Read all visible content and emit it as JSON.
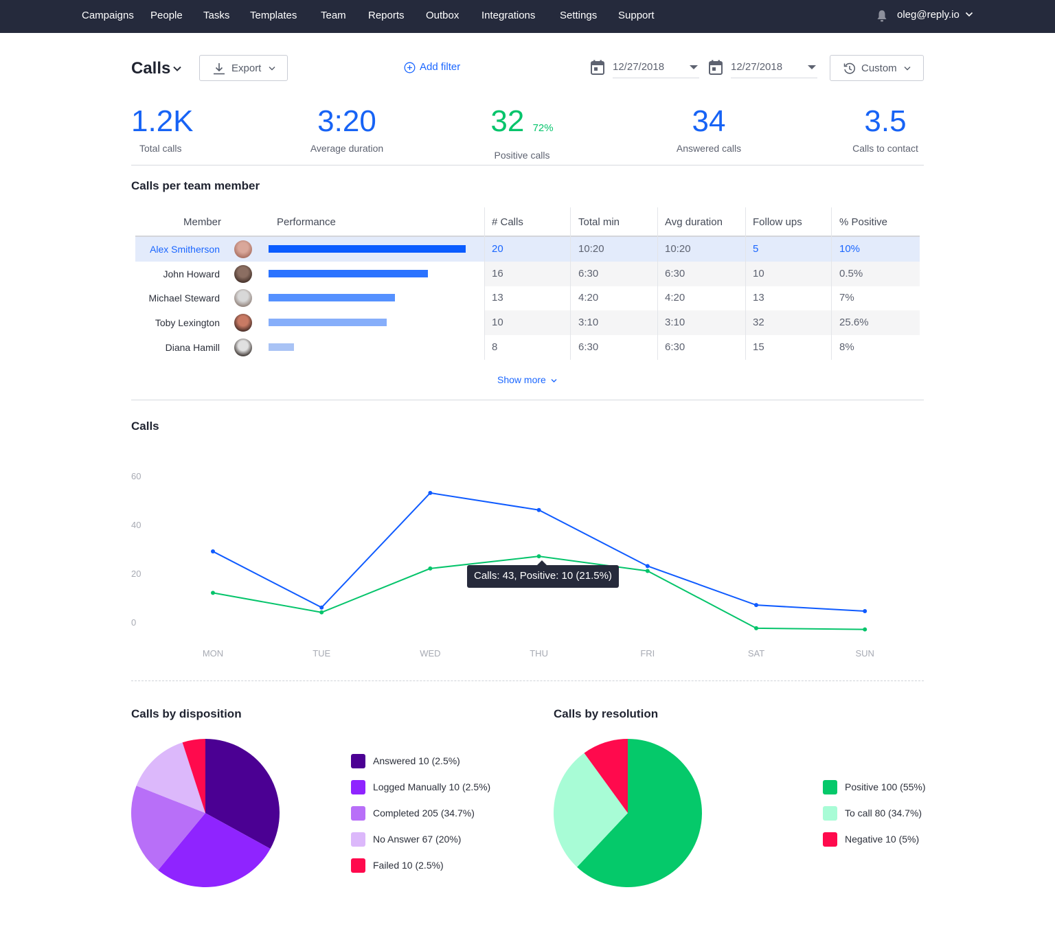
{
  "nav": {
    "items": [
      "Campaigns",
      "People",
      "Tasks",
      "Templates",
      "Team",
      "Reports",
      "Outbox",
      "Integrations",
      "Settings",
      "Support"
    ],
    "user_email": "oleg@reply.io"
  },
  "header": {
    "title": "Calls",
    "export_label": "Export",
    "add_filter_label": "Add filter",
    "date_from": "12/27/2018",
    "date_to": "12/27/2018",
    "range_label": "Custom"
  },
  "stats": [
    {
      "value": "1.2K",
      "label": "Total calls"
    },
    {
      "value": "3:20",
      "label": "Average duration"
    },
    {
      "value": "32",
      "sub": "72%",
      "label": "Positive calls"
    },
    {
      "value": "34",
      "label": "Answered calls"
    },
    {
      "value": "3.5",
      "label": "Calls to contact"
    }
  ],
  "colors": {
    "accent_blue": "#1763f5",
    "positive_green": "#05c46b",
    "nav_bg": "#252a3c"
  },
  "team_table": {
    "title": "Calls per team member",
    "columns": [
      "Member",
      "Performance",
      "# Calls",
      "Total min",
      "Avg duration",
      "Follow ups",
      "% Positive"
    ],
    "rows": [
      {
        "member": "Alex Smitherson",
        "performance": 1.0,
        "calls": "20",
        "total_min": "10:20",
        "avg_duration": "10:20",
        "follow_ups": "5",
        "positive": "10%",
        "selected": true
      },
      {
        "member": "John Howard",
        "performance": 0.81,
        "calls": "16",
        "total_min": "6:30",
        "avg_duration": "6:30",
        "follow_ups": "10",
        "positive": "0.5%"
      },
      {
        "member": "Michael Steward",
        "performance": 0.64,
        "calls": "13",
        "total_min": "4:20",
        "avg_duration": "4:20",
        "follow_ups": "13",
        "positive": "7%"
      },
      {
        "member": "Toby Lexington",
        "performance": 0.6,
        "calls": "10",
        "total_min": "3:10",
        "avg_duration": "3:10",
        "follow_ups": "32",
        "positive": "25.6%"
      },
      {
        "member": "Diana Hamill",
        "performance": 0.13,
        "calls": "8",
        "total_min": "6:30",
        "avg_duration": "6:30",
        "follow_ups": "15",
        "positive": "8%"
      }
    ],
    "show_more_label": "Show more"
  },
  "calls_section_title": "Calls",
  "tooltip_text": "Calls: 43, Positive: 10 (21.5%)",
  "disposition_title": "Calls by disposition",
  "resolution_title": "Calls by resolution",
  "chart_data": [
    {
      "type": "line",
      "title": "Calls",
      "x": [
        "MON",
        "TUE",
        "WED",
        "THU",
        "FRI",
        "SAT",
        "SUN"
      ],
      "series": [
        {
          "name": "Calls",
          "color": "#0f5bff",
          "values": [
            29,
            6,
            53,
            46,
            23,
            7,
            4.5
          ]
        },
        {
          "name": "Positive",
          "color": "#05c46b",
          "values": [
            12,
            4,
            22,
            27,
            21,
            -2.5,
            -3
          ]
        }
      ],
      "yticks": [
        0,
        20,
        40,
        60
      ],
      "ylim": [
        -5,
        60
      ],
      "grid": false,
      "xlabel": "",
      "ylabel": ""
    },
    {
      "type": "pie",
      "title": "Calls by disposition",
      "legend_position": "right",
      "slices": [
        {
          "label": "Answered 10 (2.5%)",
          "value": 33,
          "color": "#4b0093"
        },
        {
          "label": "Logged Manually 10 (2.5%)",
          "value": 28,
          "color": "#8f24ff"
        },
        {
          "label": "Completed 205 (34.7%)",
          "value": 20,
          "color": "#b86ff8"
        },
        {
          "label": "No Answer 67 (20%)",
          "value": 14,
          "color": "#dcb8fb"
        },
        {
          "label": "Failed 10 (2.5%)",
          "value": 5,
          "color": "#ff0a4d"
        }
      ]
    },
    {
      "type": "pie",
      "title": "Calls by resolution",
      "legend_position": "right",
      "slices": [
        {
          "label": "Positive 100 (55%)",
          "value": 62,
          "color": "#05c96a"
        },
        {
          "label": "To call 80 (34.7%)",
          "value": 28,
          "color": "#a8fcd6"
        },
        {
          "label": "Negative 10 (5%)",
          "value": 10,
          "color": "#ff0a4d"
        }
      ]
    }
  ]
}
